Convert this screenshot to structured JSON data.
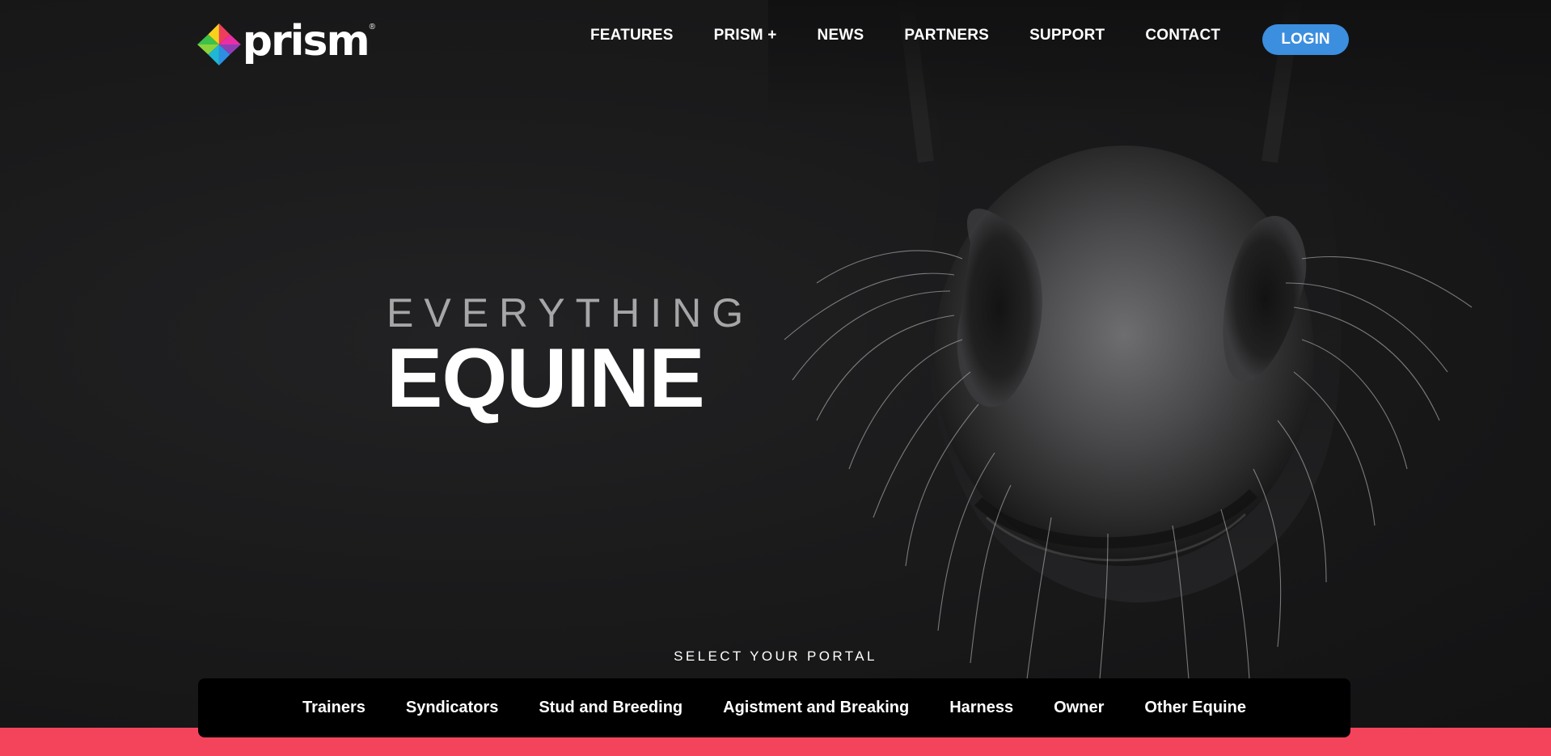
{
  "brand": {
    "name": "prism",
    "registered_mark": "®",
    "logo_icon": "prism-triangle-logo-icon",
    "logo_colors": [
      "#3cc24a",
      "#f7d21c",
      "#ef3e5c",
      "#ea2fa4",
      "#2c8fe3",
      "#8e3fb6"
    ]
  },
  "nav": {
    "items": [
      {
        "label": "FEATURES"
      },
      {
        "label": "PRISM +"
      },
      {
        "label": "NEWS"
      },
      {
        "label": "PARTNERS"
      },
      {
        "label": "SUPPORT"
      },
      {
        "label": "CONTACT"
      }
    ],
    "login_label": "LOGIN"
  },
  "hero": {
    "headline_top": "EVERYTHING",
    "headline_main": "EQUINE",
    "image": "horse-muzzle-photo"
  },
  "portals": {
    "label": "SELECT YOUR PORTAL",
    "items": [
      {
        "label": "Trainers"
      },
      {
        "label": "Syndicators"
      },
      {
        "label": "Stud and Breeding"
      },
      {
        "label": "Agistment and Breaking"
      },
      {
        "label": "Harness"
      },
      {
        "label": "Owner"
      },
      {
        "label": "Other Equine"
      }
    ]
  },
  "colors": {
    "accent": "#3c8ede",
    "strip": "#f4445c",
    "background": "#1b1b1c"
  }
}
